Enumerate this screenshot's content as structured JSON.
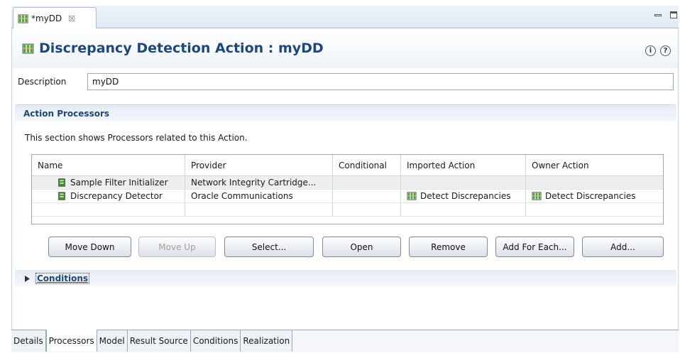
{
  "editor_tab": {
    "title": "*myDD",
    "close": "☒"
  },
  "form": {
    "title": "Discrepancy Detection Action : myDD",
    "info_icon": "i",
    "help_icon": "?"
  },
  "description": {
    "label": "Description",
    "value": "myDD"
  },
  "action_processors": {
    "header": "Action Processors",
    "desc": "This section shows Processors related to this Action.",
    "columns": [
      "Name",
      "Provider",
      "Conditional",
      "Imported Action",
      "Owner Action"
    ],
    "rows": [
      {
        "name": "Sample Filter Initializer",
        "provider": "Network Integrity Cartridge...",
        "conditional": "",
        "imported": "",
        "owner": ""
      },
      {
        "name": "Discrepancy Detector",
        "provider": "Oracle Communications",
        "conditional": "",
        "imported": "Detect Discrepancies",
        "owner": "Detect Discrepancies"
      }
    ]
  },
  "buttons": {
    "move_down": "Move Down",
    "move_up": "Move Up",
    "select": "Select...",
    "open": "Open",
    "remove": "Remove",
    "add_for_each": "Add For Each...",
    "add": "Add..."
  },
  "conditions": {
    "label": "Conditions"
  },
  "page_tabs": [
    "Details",
    "Processors",
    "Model",
    "Result Source",
    "Conditions",
    "Realization"
  ],
  "colors": {
    "title": "#1f4777",
    "header_bg": "#e3ebf5",
    "icon_green": "#3d7a3a"
  }
}
